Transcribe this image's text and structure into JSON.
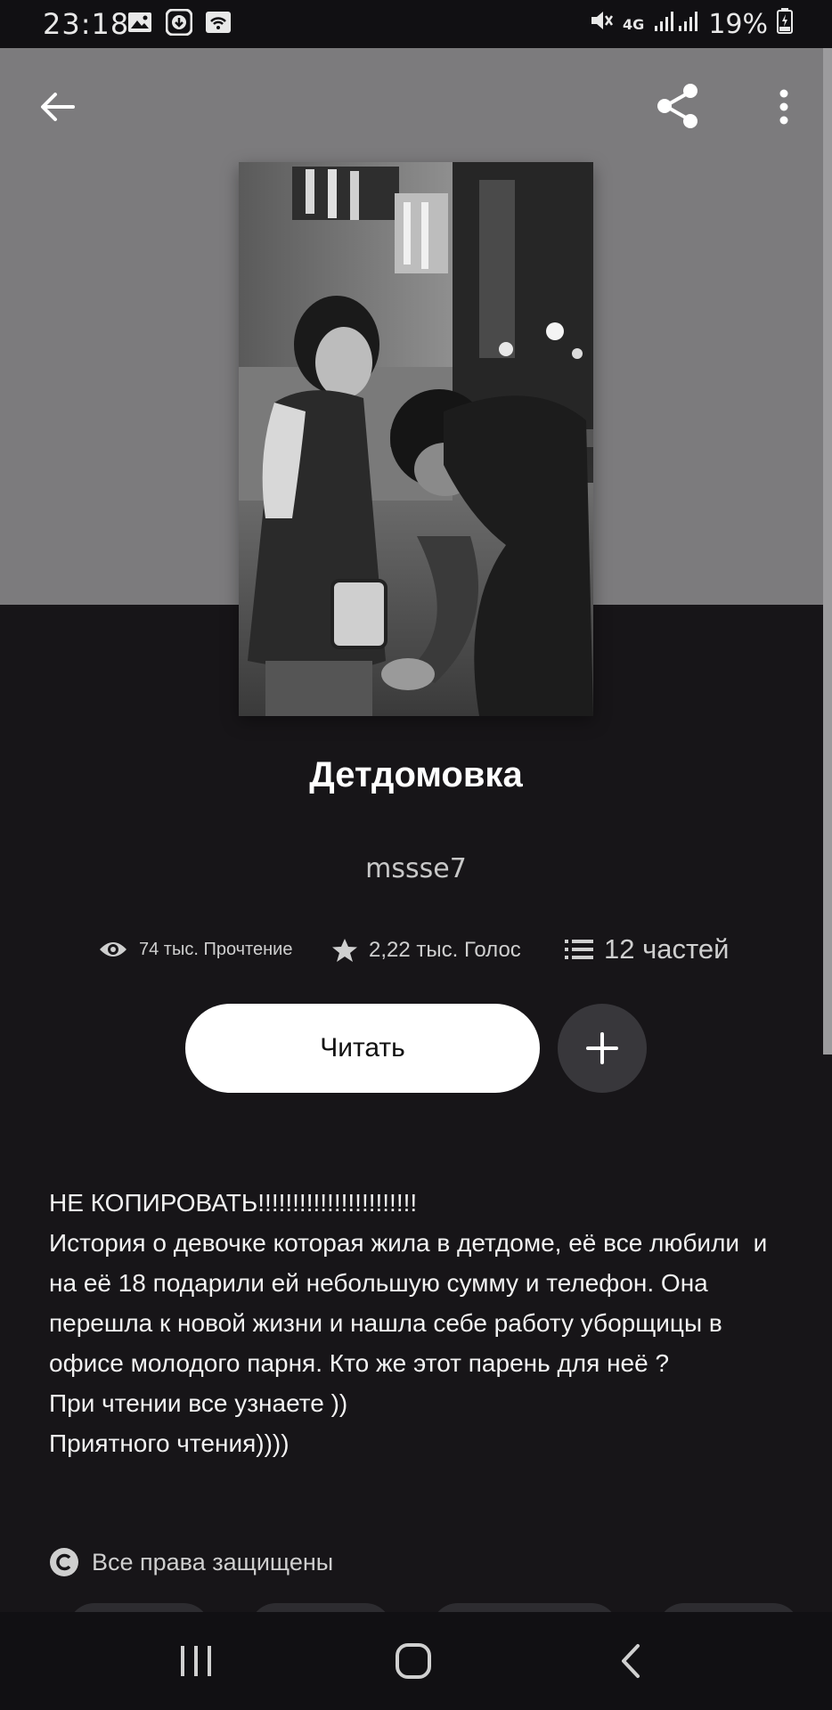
{
  "status_bar": {
    "time": "23:18",
    "network": "4G",
    "battery": "19%",
    "icons": [
      "gallery-icon",
      "download-icon",
      "wifi-icon",
      "mute-icon",
      "signal-icon",
      "battery-charging-icon"
    ]
  },
  "top_bar": {
    "back_icon": "arrow-left-icon",
    "share_icon": "share-icon",
    "more_icon": "more-vertical-icon"
  },
  "story": {
    "title": "Детдомовка",
    "author": "mssse7",
    "stats": {
      "reads": "74 тыс. Прочтение",
      "votes": "2,22 тыс. Голос",
      "parts": "12 частей"
    },
    "read_button": "Читать",
    "description": [
      "НЕ КОПИРОВАТЬ!!!!!!!!!!!!!!!!!!!!!!!",
      "История о девочке которая жила в детдоме, её все любили  и на её 18 подарили ей небольшую сумму и телефон. Она перешла к новой жизни и нашла себе работу уборщицы в офисе молодого парня. Кто же этот парень для неё ?",
      "При чтении все узнаете ))",
      "Приятного чтения))))"
    ],
    "copyright": "Все права защищены"
  },
  "colors": {
    "background": "#171518",
    "hero": "#7c7b7d",
    "button": "#ffffff",
    "add_button": "#38373b"
  }
}
